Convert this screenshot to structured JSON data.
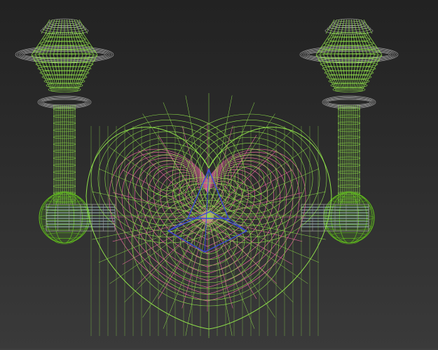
{
  "viewport": {
    "mode": "wireframe",
    "view": "front"
  },
  "colors": {
    "background_top": "#222222",
    "background_bottom": "#3a3a3a",
    "wire_green": "#8fe04a",
    "wire_green_solid": "#5fb81e",
    "wire_pink": "#e0669a",
    "wire_gray": "#9a9a9a",
    "wire_blue": "#3a4ad8",
    "wire_cyan": "#bfe6f0"
  },
  "objects": [
    {
      "name": "left-lamp-post"
    },
    {
      "name": "right-lamp-post"
    },
    {
      "name": "center-heart-shade-green"
    },
    {
      "name": "center-heart-shade-pink"
    },
    {
      "name": "center-blue-frame"
    },
    {
      "name": "left-connector-arm"
    },
    {
      "name": "right-connector-arm"
    }
  ]
}
